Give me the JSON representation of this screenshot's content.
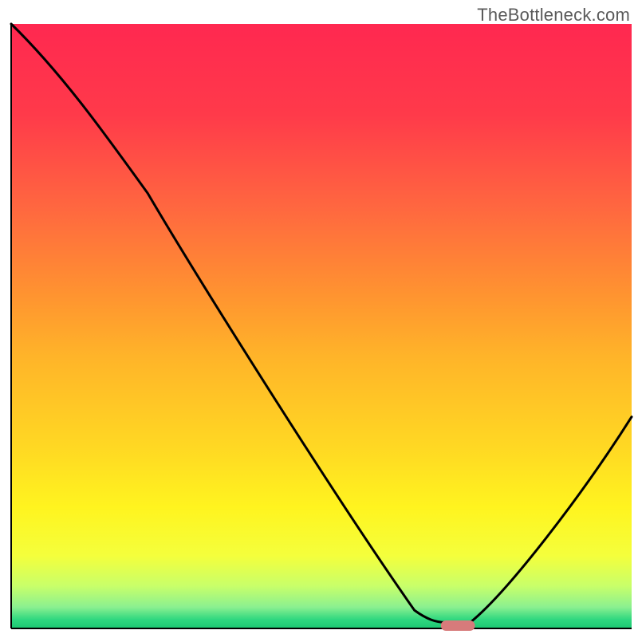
{
  "watermark": "TheBottleneck.com",
  "chart_data": {
    "type": "line",
    "title": "",
    "xlabel": "",
    "ylabel": "",
    "xlim": [
      0,
      100
    ],
    "ylim": [
      0,
      100
    ],
    "x": [
      0,
      22,
      65,
      70,
      74,
      100
    ],
    "values": [
      100,
      72,
      3,
      1,
      1,
      35
    ],
    "marker": {
      "x_center": 72,
      "x_width": 5.5,
      "y": 0.5,
      "color": "#d77b7b"
    },
    "gradient_stops": [
      {
        "offset": 0.0,
        "color": "#ff2850"
      },
      {
        "offset": 0.15,
        "color": "#ff3a4a"
      },
      {
        "offset": 0.3,
        "color": "#ff6640"
      },
      {
        "offset": 0.45,
        "color": "#ff9430"
      },
      {
        "offset": 0.55,
        "color": "#ffb429"
      },
      {
        "offset": 0.7,
        "color": "#ffd823"
      },
      {
        "offset": 0.8,
        "color": "#fff41f"
      },
      {
        "offset": 0.88,
        "color": "#f4ff3c"
      },
      {
        "offset": 0.93,
        "color": "#c8ff6a"
      },
      {
        "offset": 0.965,
        "color": "#8af090"
      },
      {
        "offset": 0.985,
        "color": "#30d880"
      },
      {
        "offset": 1.0,
        "color": "#1cc772"
      }
    ],
    "curve_color": "#000000",
    "curve_width": 3
  }
}
